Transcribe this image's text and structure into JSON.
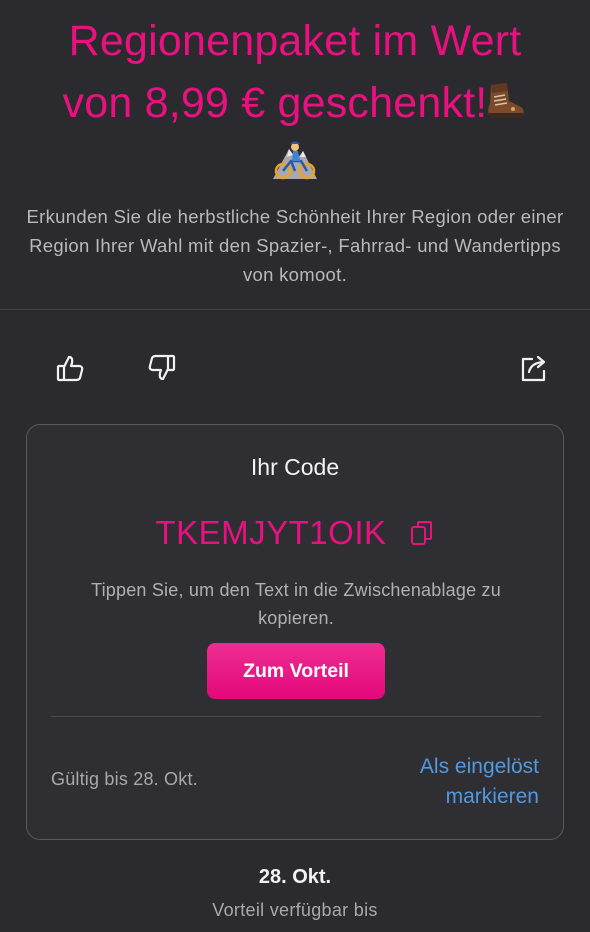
{
  "offer": {
    "title_line1": "Regionenpaket im Wert",
    "title_line2": "von 8,99 € geschenkt!",
    "description": "Erkunden Sie die herbstliche Schönheit Ihrer Region oder einer Region Ihrer Wahl mit den Spazier-, Fahrrad- und Wandertipps von komoot.",
    "accent_color": "#e8117f"
  },
  "actions": {
    "like_icon": "thumbs-up-icon",
    "dislike_icon": "thumbs-down-icon",
    "share_icon": "share-icon"
  },
  "code_card": {
    "heading": "Ihr Code",
    "code": "TKEMJYT1OIK",
    "hint": "Tippen Sie, um den Text in die Zwischenablage zu kopieren.",
    "cta_label": "Zum Vorteil",
    "valid_until": "Gültig bis 28. Okt.",
    "redeem_line1": "Als eingelöst",
    "redeem_line2": "markieren",
    "link_color": "#4f9ae0"
  },
  "footer": {
    "date": "28. Okt.",
    "label": "Vorteil verfügbar bis"
  }
}
